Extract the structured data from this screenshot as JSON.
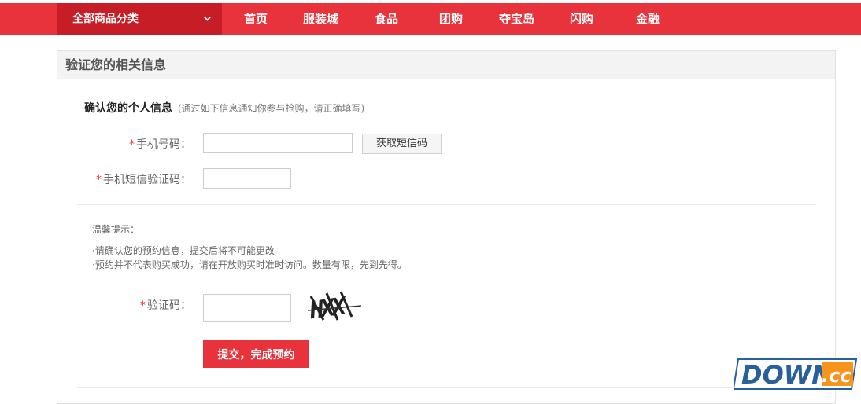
{
  "nav": {
    "category_label": "全部商品分类",
    "items": [
      "首页",
      "服装城",
      "食品",
      "团购",
      "夺宝岛",
      "闪购",
      "金融"
    ]
  },
  "panel": {
    "title": "验证您的相关信息",
    "section_title": "确认您的个人信息",
    "section_note": "(通过如下信息通知你参与抢购，请正确填写)"
  },
  "form": {
    "required_mark": "*",
    "phone_label": "手机号码：",
    "phone_value": "",
    "sms_button": "获取短信码",
    "sms_code_label": "手机短信验证码：",
    "sms_code_value": "",
    "captcha_label": "验证码：",
    "captcha_value": "",
    "captcha_text": "HXX",
    "submit_button": "提交，完成预约"
  },
  "tips": {
    "title": "温馨提示：",
    "lines": [
      "·请确认您的预约信息，提交后将不可能更改",
      "·预约并不代表购买成功，请在开放购买时准时访问。数量有限，先到先得。"
    ]
  },
  "watermark": {
    "text": "DOWN",
    "suffix": ".cc"
  },
  "colors": {
    "brand_red": "#e8323c",
    "category_red": "#c71d26",
    "watermark_blue": "#2a5f9e",
    "watermark_orange": "#f7941d"
  }
}
